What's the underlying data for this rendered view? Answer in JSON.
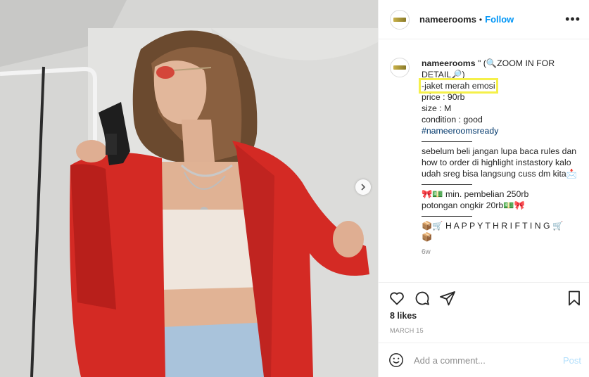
{
  "post": {
    "username": "nameerooms",
    "follow_label": "Follow",
    "more_label": "•••",
    "separator_dot": "•"
  },
  "caption": {
    "username": "nameerooms",
    "line1": " \" (🔍ZOOM IN FOR",
    "line2": "DETAIL🔎)",
    "line3": "-jaket merah emosi",
    "line4": "price : 90rb",
    "line5": "size : M",
    "line6": "condition : good",
    "hashtag": "#nameeroomsready",
    "para": "sebelum beli jangan lupa baca rules dan how to order di highlight instastory kalo udah sreg bisa langsung cuss dm kita📩",
    "rule1": "🎀💵 min. pembelian 250rb",
    "rule2": "potongan ongkir 20rb💵🎀",
    "happy": "📦🛒 H A P P Y T H R I F T I N G 🛒",
    "happy2": "📦",
    "time": "6w"
  },
  "stats": {
    "likes": "8 likes",
    "date": "MARCH 15"
  },
  "comment": {
    "placeholder": "Add a comment...",
    "post_label": "Post"
  },
  "icons": [
    "heart-icon",
    "comment-icon",
    "share-icon",
    "bookmark-icon",
    "emoji-icon",
    "chevron-right-icon",
    "more-icon"
  ],
  "colors": {
    "link": "#0095f6",
    "hashtag": "#00376b",
    "highlight": "#f5f04a",
    "jacket": "#d42a24",
    "muted": "#8e8e8e"
  }
}
